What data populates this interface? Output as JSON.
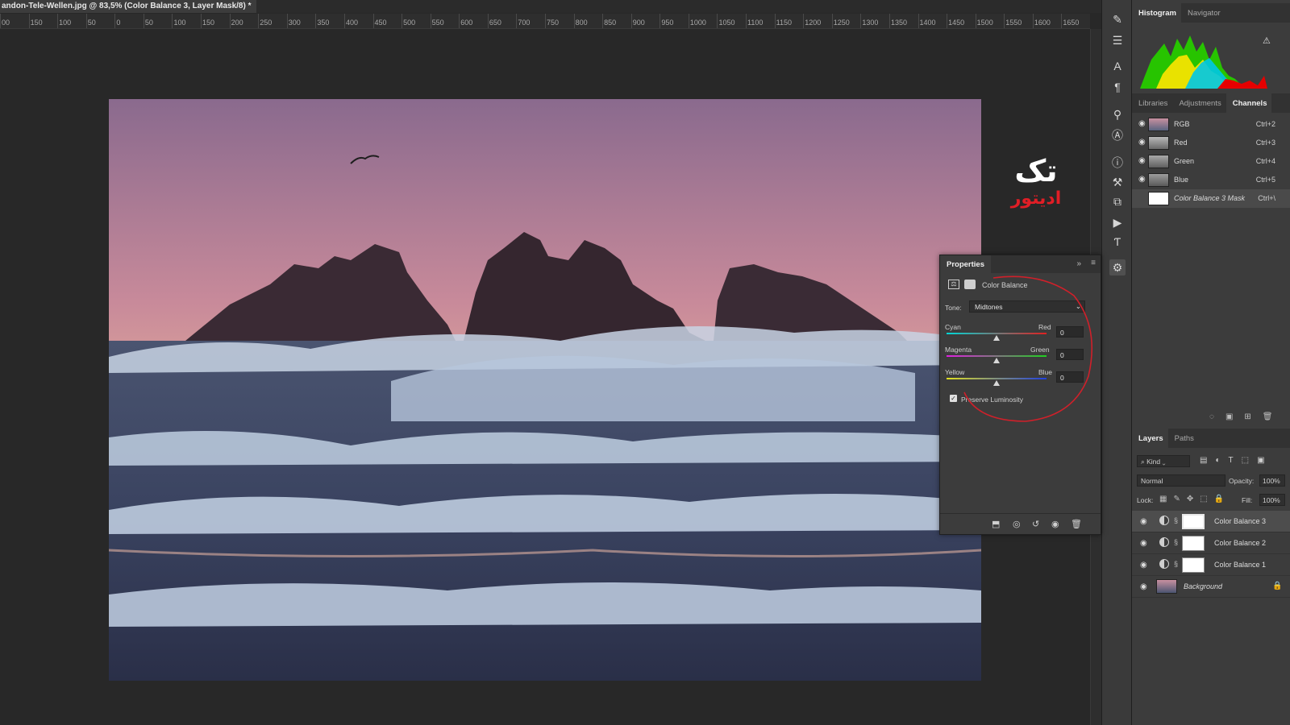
{
  "document": {
    "tab_title": "andon-Tele-Wellen.jpg @ 83,5% (Color Balance 3, Layer Mask/8) *",
    "close_glyph": "×"
  },
  "ruler": {
    "ticks": [
      "00",
      "150",
      "100",
      "50",
      "0",
      "50",
      "100",
      "150",
      "200",
      "250",
      "300",
      "350",
      "400",
      "450",
      "500",
      "550",
      "600",
      "650",
      "700",
      "750",
      "800",
      "850",
      "900",
      "950",
      "1000",
      "1050",
      "1100",
      "1150",
      "1200",
      "1250",
      "1300",
      "1350",
      "1400",
      "1450",
      "1500",
      "1550",
      "1600",
      "1650"
    ]
  },
  "watermark": {
    "line1": "تک",
    "line2": "ادیتور"
  },
  "top_panel": {
    "tabs": [
      "Histogram",
      "Navigator"
    ],
    "active_tab": "Histogram",
    "warning_icon": "warning-icon"
  },
  "channels_panel": {
    "tabs": [
      "Libraries",
      "Adjustments",
      "Channels"
    ],
    "active_tab": "Channels",
    "rows": [
      {
        "name": "RGB",
        "shortcut": "Ctrl+2"
      },
      {
        "name": "Red",
        "shortcut": "Ctrl+3"
      },
      {
        "name": "Green",
        "shortcut": "Ctrl+4"
      },
      {
        "name": "Blue",
        "shortcut": "Ctrl+5"
      },
      {
        "name": "Color Balance 3 Mask",
        "shortcut": "Ctrl+\\"
      }
    ]
  },
  "layers_panel": {
    "tabs": [
      "Layers",
      "Paths"
    ],
    "active_tab": "Layers",
    "filter_kind": "Kind",
    "blend_mode": "Normal",
    "opacity_label": "Opacity:",
    "opacity_value": "100%",
    "lock_label": "Lock:",
    "fill_label": "Fill:",
    "fill_value": "100%",
    "layers": [
      {
        "name": "Color Balance 3"
      },
      {
        "name": "Color Balance 2"
      },
      {
        "name": "Color Balance 1"
      },
      {
        "name": "Background"
      }
    ]
  },
  "properties": {
    "title": "Properties",
    "adjustment_name": "Color Balance",
    "tone_label": "Tone:",
    "tone_value": "Midtones",
    "sliders": [
      {
        "left": "Cyan",
        "right": "Red",
        "value": "0",
        "level": 0.5
      },
      {
        "left": "Magenta",
        "right": "Green",
        "value": "0",
        "level": 0.5
      },
      {
        "left": "Yellow",
        "right": "Blue",
        "value": "0",
        "level": 0.5
      }
    ],
    "preserve_luminosity_label": "Preserve Luminosity",
    "preserve_luminosity": true
  },
  "colors": {
    "annotation_circle": "#d0202a",
    "panel_bg": "#3c3c3c",
    "watermark_red": "#e01e26"
  }
}
